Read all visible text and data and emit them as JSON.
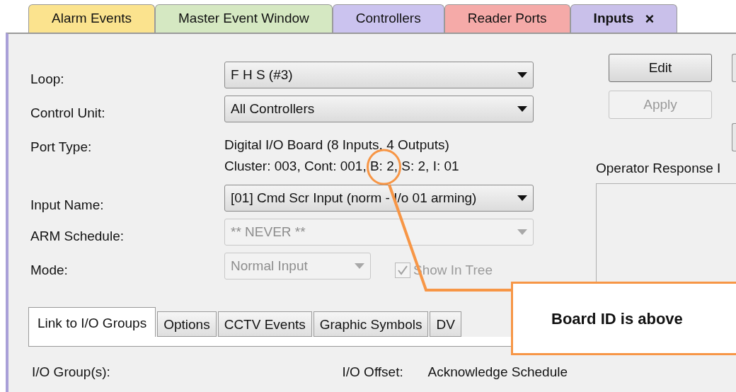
{
  "tabs": [
    {
      "label": "Alarm Events",
      "color": "#fbe38e",
      "selected": false,
      "closable": false
    },
    {
      "label": "Master Event Window",
      "color": "#d5e8c2",
      "selected": false,
      "closable": false
    },
    {
      "label": "Controllers",
      "color": "#cbc3ef",
      "selected": false,
      "closable": false
    },
    {
      "label": "Reader Ports",
      "color": "#f5aaa8",
      "selected": false,
      "closable": false
    },
    {
      "label": "Inputs",
      "color": "#c9c0ea",
      "selected": true,
      "closable": true,
      "close_glyph": "×"
    }
  ],
  "form": {
    "loop": {
      "label": "Loop:",
      "value": "F H S (#3)",
      "disabled": false
    },
    "control_unit": {
      "label": "Control Unit:",
      "value": "All Controllers",
      "disabled": false
    },
    "port_type": {
      "label": "Port Type:",
      "lines": [
        "Digital I/O Board (8 Inputs, 4 Outputs)",
        "Cluster: 003, Cont: 001, B: 2, S: 2, I: 01"
      ]
    },
    "input_name": {
      "label": "Input Name:",
      "value": "[01] Cmd Scr Input (norm - I/o 01 arming)",
      "disabled": false
    },
    "arm_schedule": {
      "label": "ARM Schedule:",
      "value": "** NEVER **",
      "disabled": true
    },
    "mode": {
      "label": "Mode:",
      "value": "Normal Input",
      "disabled": true
    },
    "show_in_tree": {
      "label": "Show In Tree",
      "checked": true,
      "disabled": true
    }
  },
  "buttons": [
    {
      "label": "Edit",
      "disabled": false
    },
    {
      "label": "Apply",
      "disabled": true
    }
  ],
  "operator_response": {
    "label": "Operator Response I"
  },
  "sub_tabs": [
    {
      "label": "Link to I/O Groups",
      "selected": true
    },
    {
      "label": "Options",
      "selected": false
    },
    {
      "label": "CCTV Events",
      "selected": false
    },
    {
      "label": "Graphic Symbols",
      "selected": false
    },
    {
      "label": "DV",
      "selected": false
    }
  ],
  "bottom_labels": {
    "io_groups": "I/O Group(s):",
    "io_offset": "I/O Offset:",
    "acknowledge_schedule": "Acknowledge Schedule"
  },
  "callout": {
    "text": "Board ID is above"
  }
}
